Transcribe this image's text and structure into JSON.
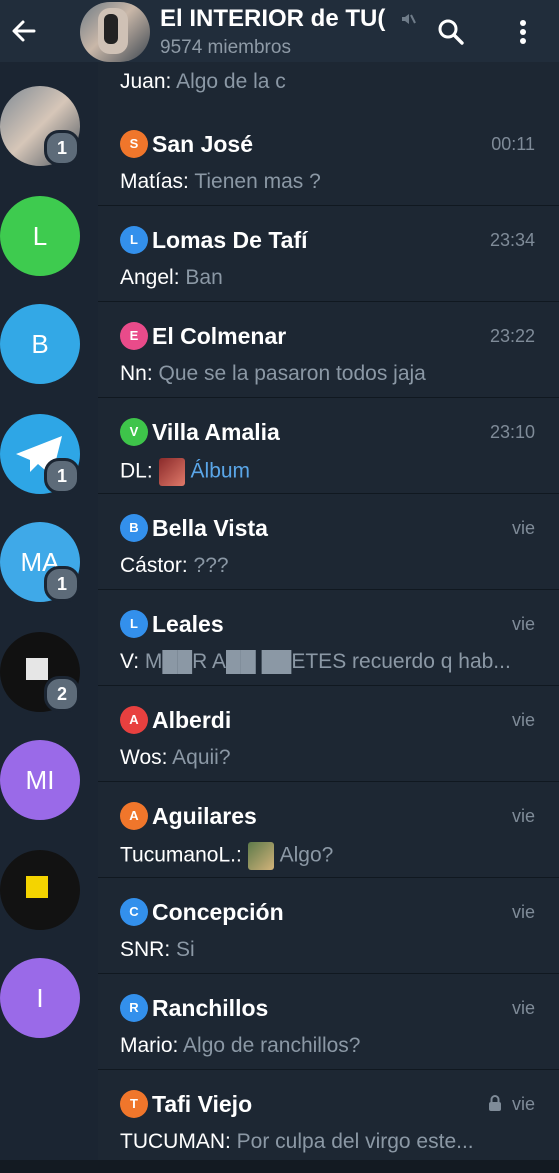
{
  "header": {
    "title": "El INTERIOR de TU(",
    "subtitle": "9574 miembros"
  },
  "partial_row": {
    "sender": "Juan:",
    "text": "Algo de la c"
  },
  "sidebar": [
    {
      "type": "photo",
      "letters": "",
      "color": "#6c7a88",
      "badge": "1"
    },
    {
      "type": "letter",
      "letters": "L",
      "color": "#3ecb4f",
      "badge": ""
    },
    {
      "type": "letter",
      "letters": "B",
      "color": "#33a8e6",
      "badge": ""
    },
    {
      "type": "letter",
      "letters": "",
      "color": "#2ea6e6",
      "badge": "1"
    },
    {
      "type": "letter",
      "letters": "MA",
      "color": "#3fa9e8",
      "badge": "1"
    },
    {
      "type": "photo",
      "letters": "",
      "color": "#111111",
      "badge": "2"
    },
    {
      "type": "letter",
      "letters": "MI",
      "color": "#9a6ae8",
      "badge": ""
    },
    {
      "type": "photo",
      "letters": "",
      "color": "#121212",
      "badge": ""
    },
    {
      "type": "letter",
      "letters": "I",
      "color": "#9a6ae8",
      "badge": ""
    }
  ],
  "topics": [
    {
      "badge_letter": "S",
      "badge_color": "#f0762b",
      "name": "San José",
      "time": "00:11",
      "sender": "Matías:",
      "text": "Tienen mas ?",
      "link": false,
      "thumb": false,
      "locked": false
    },
    {
      "badge_letter": "L",
      "badge_color": "#3390ec",
      "name": "Lomas De Tafí",
      "time": "23:34",
      "sender": "Angel:",
      "text": "Ban",
      "link": false,
      "thumb": false,
      "locked": false
    },
    {
      "badge_letter": "E",
      "badge_color": "#e94b8a",
      "name": "El Colmenar",
      "time": "23:22",
      "sender": "Nn:",
      "text": "Que se la pasaron todos jaja",
      "link": false,
      "thumb": false,
      "locked": false
    },
    {
      "badge_letter": "V",
      "badge_color": "#3ec44a",
      "name": "Villa Amalia",
      "time": "23:10",
      "sender": "DL:",
      "text": "Álbum",
      "link": true,
      "thumb": true,
      "locked": false
    },
    {
      "badge_letter": "B",
      "badge_color": "#3390ec",
      "name": "Bella Vista",
      "time": "vie",
      "sender": "Cástor:",
      "text": "???",
      "link": false,
      "thumb": false,
      "locked": false
    },
    {
      "badge_letter": "L",
      "badge_color": "#3390ec",
      "name": "Leales",
      "time": "vie",
      "sender": "V:",
      "text": "M██R A██ ██ETES recuerdo q hab...",
      "link": false,
      "thumb": false,
      "locked": false
    },
    {
      "badge_letter": "A",
      "badge_color": "#e8403f",
      "name": "Alberdi",
      "time": "vie",
      "sender": "Wos:",
      "text": "Aquii?",
      "link": false,
      "thumb": false,
      "locked": false
    },
    {
      "badge_letter": "A",
      "badge_color": "#f0762b",
      "name": "Aguilares",
      "time": "vie",
      "sender": "TucumanoL.:",
      "text": "Algo?",
      "link": false,
      "thumb": true,
      "locked": false
    },
    {
      "badge_letter": "C",
      "badge_color": "#3390ec",
      "name": "Concepción",
      "time": "vie",
      "sender": "SNR:",
      "text": "Si",
      "link": false,
      "thumb": false,
      "locked": false
    },
    {
      "badge_letter": "R",
      "badge_color": "#3390ec",
      "name": "Ranchillos",
      "time": "vie",
      "sender": "Mario:",
      "text": "Algo de ranchillos?",
      "link": false,
      "thumb": false,
      "locked": false
    },
    {
      "badge_letter": "T",
      "badge_color": "#f0762b",
      "name": "Tafi Viejo",
      "time": "vie",
      "sender": "TUCUMAN:",
      "text": "Por culpa del virgo este...",
      "link": false,
      "thumb": false,
      "locked": true
    }
  ]
}
